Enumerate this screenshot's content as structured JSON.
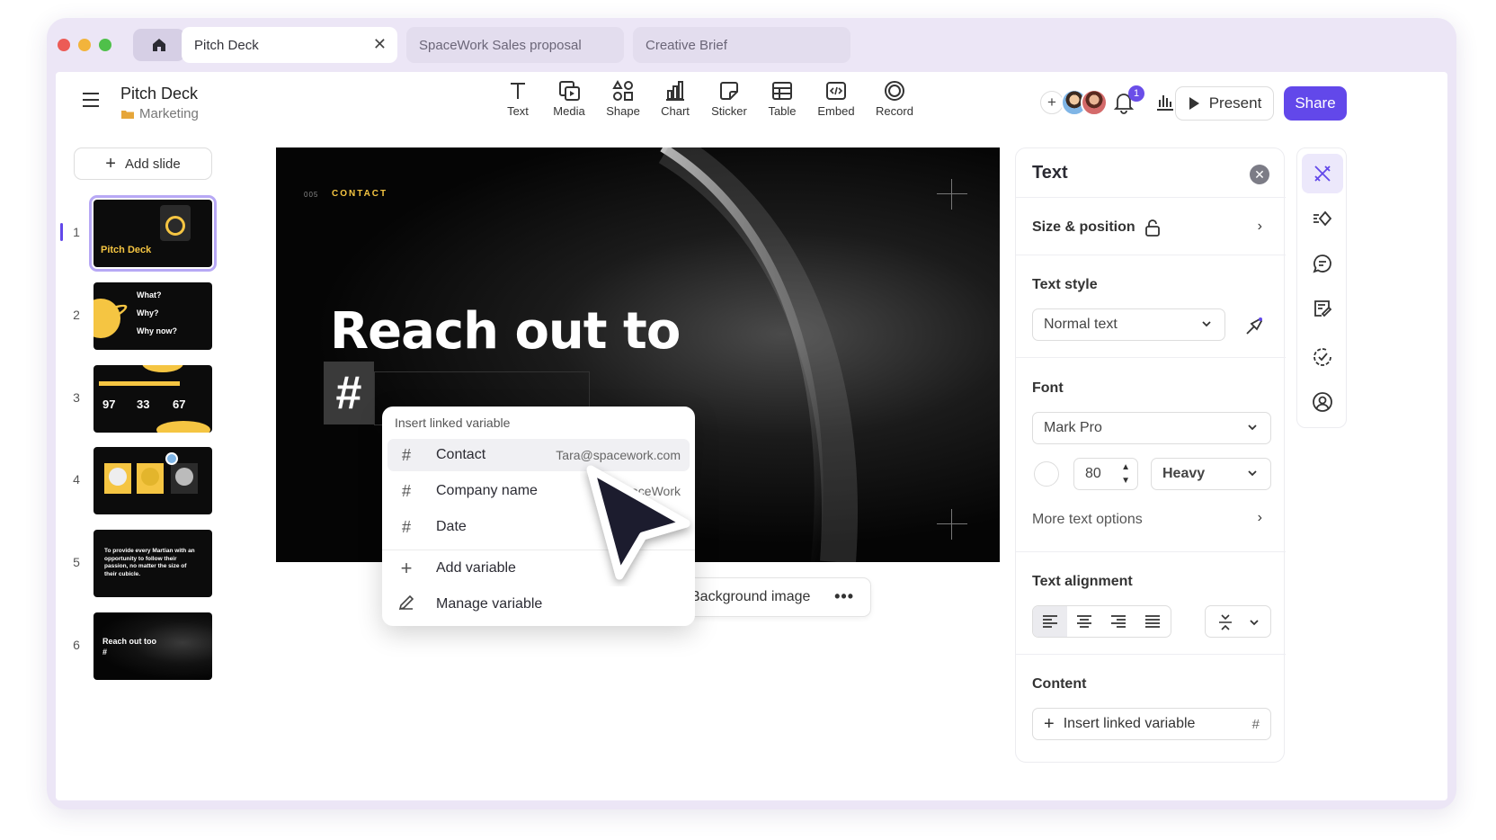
{
  "tabs": [
    {
      "label": "Pitch Deck",
      "active": true
    },
    {
      "label": "SpaceWork Sales proposal",
      "active": false
    },
    {
      "label": "Creative Brief",
      "active": false
    }
  ],
  "doc": {
    "title": "Pitch Deck",
    "folder": "Marketing"
  },
  "toolbar": [
    {
      "label": "Text",
      "icon": "text-icon"
    },
    {
      "label": "Media",
      "icon": "media-icon"
    },
    {
      "label": "Shape",
      "icon": "shape-icon"
    },
    {
      "label": "Chart",
      "icon": "chart-icon"
    },
    {
      "label": "Sticker",
      "icon": "sticker-icon"
    },
    {
      "label": "Table",
      "icon": "table-icon"
    },
    {
      "label": "Embed",
      "icon": "embed-icon"
    },
    {
      "label": "Record",
      "icon": "record-icon"
    }
  ],
  "header": {
    "notification_count": "1",
    "present_label": "Present",
    "share_label": "Share"
  },
  "sidebar": {
    "add_slide_label": "Add slide",
    "slides": [
      {
        "num": "1",
        "title": "Pitch Deck",
        "selected": true
      },
      {
        "num": "2",
        "lines": [
          "What?",
          "Why?",
          "Why now?"
        ]
      },
      {
        "num": "3",
        "stats": [
          "97",
          "33",
          "67"
        ]
      },
      {
        "num": "4"
      },
      {
        "num": "5",
        "text": "To provide every Martian with an opportunity to follow their passion, no matter the size of their cubicle."
      },
      {
        "num": "6",
        "lines": [
          "Reach out too",
          "#"
        ]
      }
    ]
  },
  "canvas": {
    "section_number": "005",
    "section_label": "CONTACT",
    "headline": "Reach out to",
    "variable_placeholder": "#"
  },
  "context_bar": {
    "label": "Background image",
    "more": "•••"
  },
  "variable_menu": {
    "header": "Insert linked variable",
    "items": [
      {
        "icon": "#",
        "label": "Contact",
        "value": "Tara@spacework.com"
      },
      {
        "icon": "#",
        "label": "Company name",
        "value": "SpaceWork"
      },
      {
        "icon": "#",
        "label": "Date",
        "value": ""
      }
    ],
    "actions": [
      {
        "icon": "+",
        "label": "Add variable"
      },
      {
        "icon": "pencil",
        "label": "Manage variable"
      }
    ]
  },
  "panel": {
    "title": "Text",
    "size_position_label": "Size & position",
    "text_style_heading": "Text style",
    "text_style_value": "Normal text",
    "font_heading": "Font",
    "font_value": "Mark Pro",
    "font_size": "80",
    "font_weight": "Heavy",
    "more_text_options": "More text options",
    "alignment_heading": "Text alignment",
    "content_heading": "Content",
    "insert_variable_label": "Insert linked variable",
    "insert_variable_hash": "#"
  },
  "colors": {
    "accent": "#6248ea",
    "slide_accent": "#f5c542",
    "window_bg": "#ece6f6"
  }
}
